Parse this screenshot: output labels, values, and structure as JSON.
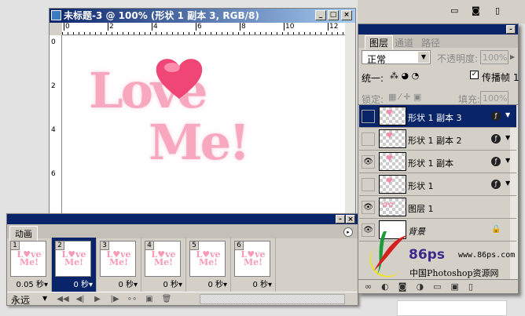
{
  "document": {
    "title": "未标题-3 @ 100% (形状 1 副本 3, RGB/8)",
    "ruler_h": [
      "0",
      "2",
      "4",
      "6",
      "8",
      "10",
      "12"
    ],
    "ruler_v": [
      "0",
      "2",
      "4",
      "6"
    ],
    "artwork_text": [
      "Love",
      "Me!"
    ]
  },
  "animation": {
    "tab": "动画",
    "frames": [
      {
        "n": "1",
        "delay": "0.05 秒▾"
      },
      {
        "n": "2",
        "delay": "0 秒▾"
      },
      {
        "n": "3",
        "delay": "0 秒▾"
      },
      {
        "n": "4",
        "delay": "0 秒▾"
      },
      {
        "n": "5",
        "delay": "0 秒▾"
      },
      {
        "n": "6",
        "delay": "0 秒▾"
      }
    ],
    "thumb_text": [
      "L♥ve",
      "Me!"
    ],
    "loop": "永远",
    "controls": [
      "◀◀",
      "◀|",
      "▶",
      "|▶",
      "∘∘",
      "▣",
      "🗑"
    ]
  },
  "layers_panel": {
    "tabs": [
      "图层",
      "通道",
      "路径"
    ],
    "blend": "正常",
    "opacity_label": "不透明度:",
    "opacity": "100%",
    "unify_label": "统一:",
    "propagate": "传播帧 1",
    "lock_label": "锁定:",
    "fill_label": "填充:",
    "fill": "100%",
    "layers": [
      {
        "name": "形状 1 副本 3",
        "visible": false,
        "selected": true
      },
      {
        "name": "形状 1 副本 2",
        "visible": false
      },
      {
        "name": "形状 1 副本",
        "visible": true
      },
      {
        "name": "形状 1",
        "visible": false
      },
      {
        "name": "图层 1",
        "visible": true
      },
      {
        "name": "背景",
        "visible": true,
        "locked": true
      }
    ],
    "bottom_icons": [
      "link",
      "fx",
      "mask",
      "adjust",
      "folder",
      "new",
      "trash"
    ]
  },
  "watermark": {
    "brand": "86ps",
    "url": "www.86ps.com",
    "site": "中国Photoshop资源网"
  }
}
